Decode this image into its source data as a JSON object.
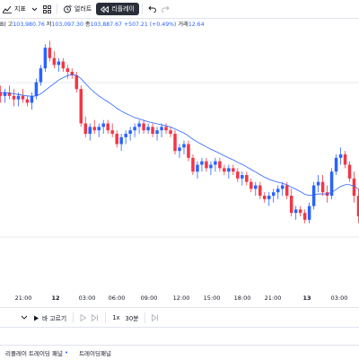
{
  "toolbar": {
    "indicators_label": "지표",
    "alerts_label": "얼러트",
    "replay_label": "리플레이"
  },
  "ohlc": {
    "prefix": "B)",
    "high_label": "고",
    "high": "103,980.76",
    "low_label": "저",
    "low": "103,097.30",
    "close_label": "종",
    "close": "103,887.67",
    "change": "+507.21 (+0.49%)",
    "volume_label": "거래",
    "volume": "12.64"
  },
  "colors": {
    "up": "#2962ff",
    "down": "#f23645",
    "ma": "#2962ff",
    "grid": "#e8eaf0"
  },
  "chart_data": {
    "type": "candlestick",
    "x_tick_labels": [
      "21:00",
      "12",
      "03:00",
      "06:00",
      "09:00",
      "12:00",
      "15:00",
      "18:00",
      "21:00",
      "13",
      "03:00"
    ],
    "candles": [
      {
        "o": 82,
        "h": 84,
        "l": 79,
        "c": 81
      },
      {
        "o": 81,
        "h": 83,
        "l": 79,
        "c": 82
      },
      {
        "o": 82,
        "h": 84,
        "l": 80,
        "c": 81
      },
      {
        "o": 81,
        "h": 83,
        "l": 78,
        "c": 80
      },
      {
        "o": 80,
        "h": 82,
        "l": 78,
        "c": 81
      },
      {
        "o": 81,
        "h": 83,
        "l": 79,
        "c": 80
      },
      {
        "o": 80,
        "h": 81,
        "l": 78,
        "c": 79
      },
      {
        "o": 79,
        "h": 82,
        "l": 77,
        "c": 81
      },
      {
        "o": 81,
        "h": 86,
        "l": 80,
        "c": 85
      },
      {
        "o": 85,
        "h": 90,
        "l": 84,
        "c": 89
      },
      {
        "o": 89,
        "h": 96,
        "l": 88,
        "c": 95
      },
      {
        "o": 95,
        "h": 97,
        "l": 91,
        "c": 92
      },
      {
        "o": 92,
        "h": 94,
        "l": 89,
        "c": 90
      },
      {
        "o": 90,
        "h": 92,
        "l": 88,
        "c": 91
      },
      {
        "o": 91,
        "h": 92,
        "l": 88,
        "c": 89
      },
      {
        "o": 89,
        "h": 90,
        "l": 86,
        "c": 88
      },
      {
        "o": 88,
        "h": 89,
        "l": 86,
        "c": 87
      },
      {
        "o": 87,
        "h": 88,
        "l": 82,
        "c": 83
      },
      {
        "o": 83,
        "h": 84,
        "l": 72,
        "c": 73
      },
      {
        "o": 73,
        "h": 75,
        "l": 69,
        "c": 70
      },
      {
        "o": 70,
        "h": 73,
        "l": 68,
        "c": 72
      },
      {
        "o": 72,
        "h": 74,
        "l": 70,
        "c": 71
      },
      {
        "o": 71,
        "h": 73,
        "l": 69,
        "c": 72
      },
      {
        "o": 72,
        "h": 74,
        "l": 70,
        "c": 73
      },
      {
        "o": 73,
        "h": 74,
        "l": 70,
        "c": 71
      },
      {
        "o": 71,
        "h": 73,
        "l": 69,
        "c": 70
      },
      {
        "o": 70,
        "h": 71,
        "l": 66,
        "c": 67
      },
      {
        "o": 67,
        "h": 70,
        "l": 65,
        "c": 69
      },
      {
        "o": 69,
        "h": 71,
        "l": 67,
        "c": 70
      },
      {
        "o": 70,
        "h": 72,
        "l": 68,
        "c": 71
      },
      {
        "o": 71,
        "h": 73,
        "l": 69,
        "c": 72
      },
      {
        "o": 72,
        "h": 74,
        "l": 70,
        "c": 73
      },
      {
        "o": 73,
        "h": 74,
        "l": 70,
        "c": 71
      },
      {
        "o": 71,
        "h": 73,
        "l": 70,
        "c": 72
      },
      {
        "o": 72,
        "h": 73,
        "l": 69,
        "c": 70
      },
      {
        "o": 70,
        "h": 72,
        "l": 68,
        "c": 71
      },
      {
        "o": 71,
        "h": 73,
        "l": 69,
        "c": 72
      },
      {
        "o": 72,
        "h": 73,
        "l": 70,
        "c": 71
      },
      {
        "o": 71,
        "h": 72,
        "l": 69,
        "c": 70
      },
      {
        "o": 70,
        "h": 71,
        "l": 64,
        "c": 65
      },
      {
        "o": 65,
        "h": 67,
        "l": 63,
        "c": 66
      },
      {
        "o": 66,
        "h": 68,
        "l": 64,
        "c": 67
      },
      {
        "o": 67,
        "h": 68,
        "l": 62,
        "c": 63
      },
      {
        "o": 63,
        "h": 64,
        "l": 58,
        "c": 59
      },
      {
        "o": 59,
        "h": 62,
        "l": 57,
        "c": 61
      },
      {
        "o": 61,
        "h": 63,
        "l": 59,
        "c": 62
      },
      {
        "o": 62,
        "h": 63,
        "l": 59,
        "c": 60
      },
      {
        "o": 60,
        "h": 62,
        "l": 58,
        "c": 61
      },
      {
        "o": 61,
        "h": 63,
        "l": 59,
        "c": 62
      },
      {
        "o": 62,
        "h": 63,
        "l": 59,
        "c": 60
      },
      {
        "o": 60,
        "h": 61,
        "l": 58,
        "c": 59
      },
      {
        "o": 59,
        "h": 61,
        "l": 57,
        "c": 60
      },
      {
        "o": 60,
        "h": 61,
        "l": 58,
        "c": 59
      },
      {
        "o": 59,
        "h": 60,
        "l": 56,
        "c": 57
      },
      {
        "o": 57,
        "h": 59,
        "l": 55,
        "c": 58
      },
      {
        "o": 58,
        "h": 59,
        "l": 55,
        "c": 56
      },
      {
        "o": 56,
        "h": 57,
        "l": 53,
        "c": 54
      },
      {
        "o": 54,
        "h": 56,
        "l": 52,
        "c": 55
      },
      {
        "o": 55,
        "h": 56,
        "l": 51,
        "c": 52
      },
      {
        "o": 52,
        "h": 53,
        "l": 50,
        "c": 51
      },
      {
        "o": 51,
        "h": 53,
        "l": 49,
        "c": 52
      },
      {
        "o": 52,
        "h": 54,
        "l": 50,
        "c": 53
      },
      {
        "o": 53,
        "h": 55,
        "l": 51,
        "c": 54
      },
      {
        "o": 54,
        "h": 56,
        "l": 52,
        "c": 55
      },
      {
        "o": 55,
        "h": 56,
        "l": 51,
        "c": 52
      },
      {
        "o": 52,
        "h": 54,
        "l": 46,
        "c": 47
      },
      {
        "o": 47,
        "h": 49,
        "l": 45,
        "c": 48
      },
      {
        "o": 48,
        "h": 49,
        "l": 46,
        "c": 47
      },
      {
        "o": 47,
        "h": 48,
        "l": 44,
        "c": 45
      },
      {
        "o": 45,
        "h": 50,
        "l": 44,
        "c": 49
      },
      {
        "o": 49,
        "h": 56,
        "l": 48,
        "c": 55
      },
      {
        "o": 55,
        "h": 58,
        "l": 53,
        "c": 56
      },
      {
        "o": 56,
        "h": 58,
        "l": 52,
        "c": 53
      },
      {
        "o": 53,
        "h": 55,
        "l": 50,
        "c": 52
      },
      {
        "o": 52,
        "h": 60,
        "l": 51,
        "c": 59
      },
      {
        "o": 59,
        "h": 64,
        "l": 58,
        "c": 63
      },
      {
        "o": 63,
        "h": 66,
        "l": 61,
        "c": 64
      },
      {
        "o": 64,
        "h": 65,
        "l": 60,
        "c": 61
      },
      {
        "o": 61,
        "h": 62,
        "l": 56,
        "c": 57
      },
      {
        "o": 57,
        "h": 59,
        "l": 50,
        "c": 52
      },
      {
        "o": 52,
        "h": 54,
        "l": 44,
        "c": 46
      }
    ],
    "ma": [
      82,
      82,
      81.8,
      81.6,
      81.4,
      81.2,
      81,
      80.9,
      81,
      81.6,
      82.6,
      83.6,
      84.6,
      85.6,
      86.3,
      86.9,
      87.2,
      87,
      86,
      84.6,
      83.2,
      82,
      81,
      80.1,
      79.3,
      78.4,
      77.4,
      76.6,
      75.9,
      75.3,
      74.7,
      74.3,
      73.9,
      73.5,
      73.2,
      72.9,
      72.6,
      72.3,
      72,
      71.4,
      70.8,
      70.2,
      69.4,
      68.4,
      67.6,
      66.9,
      66.2,
      65.5,
      64.9,
      64.3,
      63.6,
      63,
      62.4,
      61.7,
      61.1,
      60.4,
      59.6,
      58.9,
      58.1,
      57.4,
      56.8,
      56.3,
      55.9,
      55.6,
      55.2,
      54.5,
      53.9,
      53.2,
      52.4,
      52.1,
      52.3,
      52.5,
      52.5,
      52.5,
      53,
      53.8,
      54.7,
      55.2,
      55.2,
      54.8,
      53.9
    ],
    "y_range": [
      40,
      100
    ]
  },
  "replay_bar": {
    "select_bar_label": "바 고르기",
    "speed_label": "1x",
    "interval_label": "30분"
  },
  "tabs": [
    {
      "label": "리플레이 트레이딩 패널"
    },
    {
      "label": "트레이딩패널"
    }
  ]
}
